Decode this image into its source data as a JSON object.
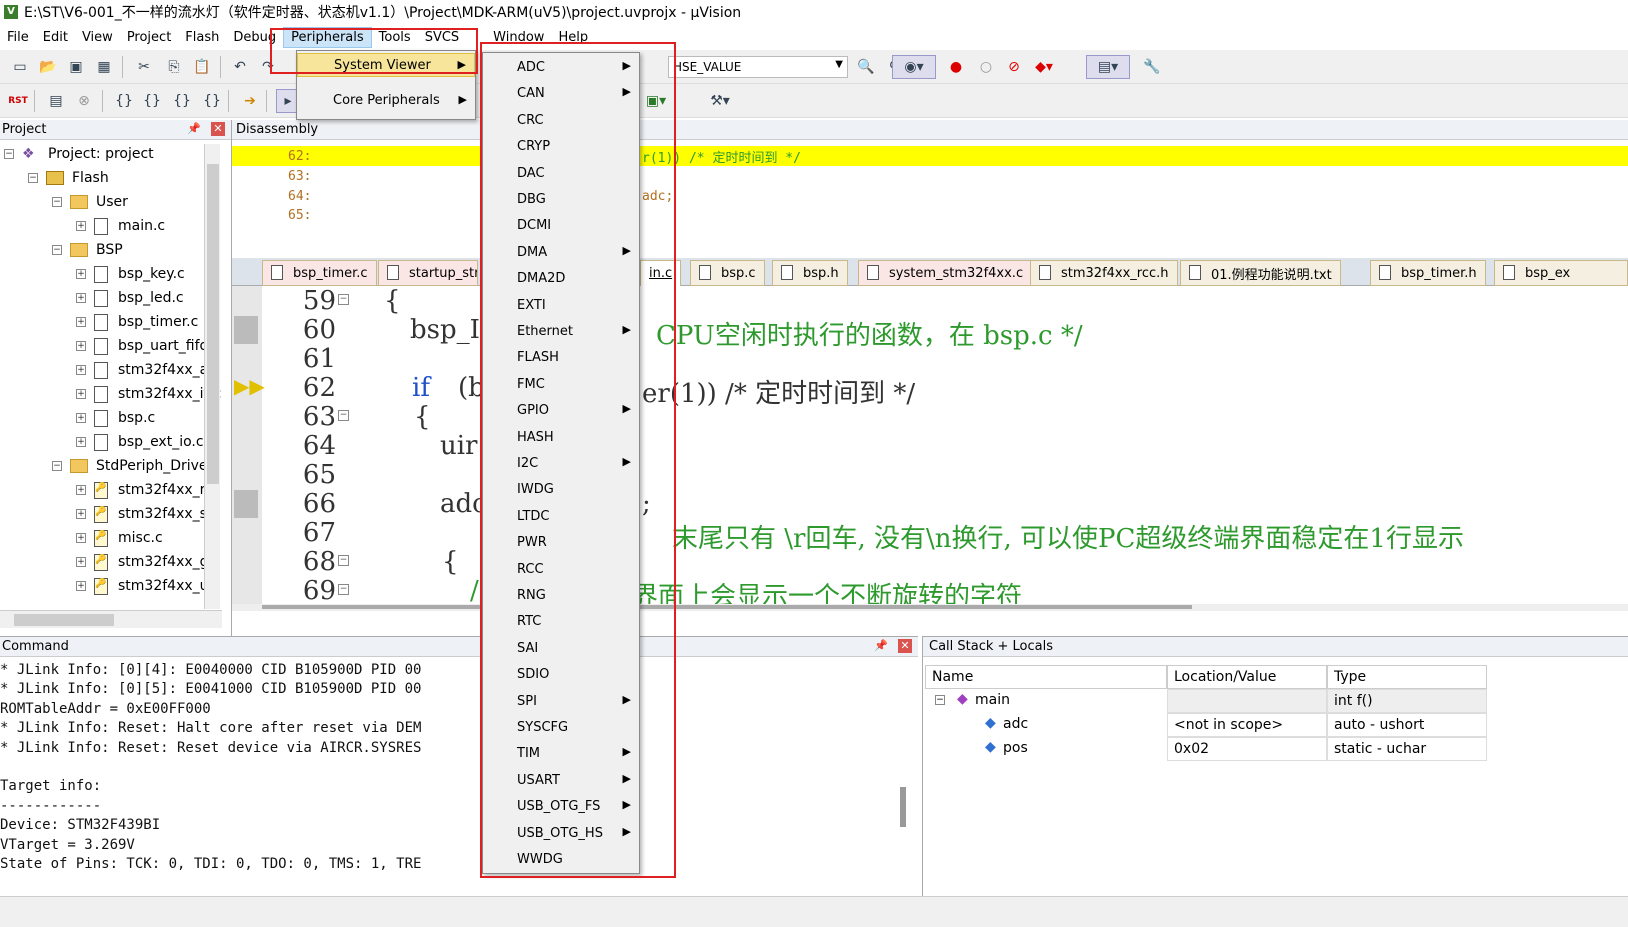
{
  "title": "E:\\ST\\V6-001_不一样的流水灯（软件定时器、状态机v1.1）\\Project\\MDK-ARM(uV5)\\project.uvprojx - µVision",
  "menubar": [
    "File",
    "Edit",
    "View",
    "Project",
    "Flash",
    "Debug",
    "Peripherals",
    "Tools",
    "SVCS",
    "Window",
    "Help"
  ],
  "toolbar": {
    "hse_value": "HSE_VALUE",
    "rst_label": "RST"
  },
  "project_panel": {
    "title": "Project",
    "items": [
      {
        "label": "Project: project",
        "level": 0,
        "kind": "project"
      },
      {
        "label": "Flash",
        "level": 1,
        "kind": "flash"
      },
      {
        "label": "User",
        "level": 2,
        "kind": "folder"
      },
      {
        "label": "main.c",
        "level": 3,
        "kind": "file"
      },
      {
        "label": "BSP",
        "level": 2,
        "kind": "folder"
      },
      {
        "label": "bsp_key.c",
        "level": 3,
        "kind": "file"
      },
      {
        "label": "bsp_led.c",
        "level": 3,
        "kind": "file"
      },
      {
        "label": "bsp_timer.c",
        "level": 3,
        "kind": "file"
      },
      {
        "label": "bsp_uart_fifo.",
        "level": 3,
        "kind": "file"
      },
      {
        "label": "stm32f4xx_as:",
        "level": 3,
        "kind": "file"
      },
      {
        "label": "stm32f4xx_it.c",
        "level": 3,
        "kind": "file"
      },
      {
        "label": "bsp.c",
        "level": 3,
        "kind": "file"
      },
      {
        "label": "bsp_ext_io.c",
        "level": 3,
        "kind": "file"
      },
      {
        "label": "StdPeriph_Driver",
        "level": 2,
        "kind": "folder"
      },
      {
        "label": "stm32f4xx_rcc",
        "level": 3,
        "kind": "hdr"
      },
      {
        "label": "stm32f4xx_sy:",
        "level": 3,
        "kind": "hdr"
      },
      {
        "label": "misc.c",
        "level": 3,
        "kind": "hdr"
      },
      {
        "label": "stm32f4xx_gp",
        "level": 3,
        "kind": "hdr"
      },
      {
        "label": "stm32f4xx_us",
        "level": 3,
        "kind": "hdr"
      }
    ]
  },
  "disassembly": {
    "title": "Disassembly",
    "lines": [
      "62:",
      "63:",
      "64:",
      "65:"
    ],
    "right_line1": "r(1)) /* 定时时间到 */",
    "right_line2": "adc;"
  },
  "tabs": [
    "bsp_timer.c",
    "startup_str",
    "in.c",
    "bsp.c",
    "bsp.h",
    "system_stm32f4xx.c",
    "stm32f4xx_rcc.h",
    "01.例程功能说明.txt",
    "bsp_timer.h",
    "bsp_ex"
  ],
  "editor": {
    "line_numbers": [
      "59",
      "60",
      "61",
      "62",
      "63",
      "64",
      "65",
      "66",
      "67",
      "68",
      "69"
    ],
    "code": {
      "l59": "{",
      "l60a": "bsp_I",
      "l60b": "CPU空闲时执行的函数，在 bsp.c */",
      "l62a": "if",
      "l62b": "(b",
      "l62c": "er(1)) /* 定时时间到 */",
      "l63": "{",
      "l64": "uir",
      "l66a": "adc",
      "l66b": ";",
      "l67a": "{",
      "l67b": "末尾只有 \\r回车, 没有\\n换行, 可以使PC超级终端界面稳定在1行显示",
      "l69a": "/",
      "l69b": "界面上会显示一个不断旋转的字符"
    }
  },
  "command": {
    "title": "Command",
    "lines": [
      "* JLink Info: [0][4]: E0040000 CID B105900D PID 00",
      "* JLink Info: [0][5]: E0041000 CID B105900D PID 00",
      "ROMTableAddr = 0xE00FF000",
      "* JLink Info: Reset: Halt core after reset via DEM",
      "* JLink Info: Reset: Reset device via AIRCR.SYSRES",
      "",
      "Target info:",
      "------------",
      "Device: STM32F439BI",
      "VTarget = 3.269V",
      "State of Pins: TCK: 0, TDI: 0, TDO: 0, TMS: 1, TRE"
    ]
  },
  "callstack": {
    "title": "Call Stack + Locals",
    "columns": [
      "Name",
      "Location/Value",
      "Type"
    ],
    "rows": [
      {
        "name": "main",
        "value": "",
        "type": "int f()"
      },
      {
        "name": "adc",
        "value": "<not in scope>",
        "type": "auto - ushort"
      },
      {
        "name": "pos",
        "value": "0x02",
        "type": "static - uchar"
      }
    ]
  },
  "peripherals_menu": {
    "items": [
      {
        "label": "System Viewer",
        "submenu": true
      },
      {
        "label": "Core Peripherals",
        "submenu": true
      }
    ]
  },
  "system_viewer_menu": {
    "items": [
      {
        "label": "ADC",
        "submenu": true
      },
      {
        "label": "CAN",
        "submenu": true
      },
      {
        "label": "CRC",
        "submenu": false
      },
      {
        "label": "CRYP",
        "submenu": false
      },
      {
        "label": "DAC",
        "submenu": false
      },
      {
        "label": "DBG",
        "submenu": false
      },
      {
        "label": "DCMI",
        "submenu": false
      },
      {
        "label": "DMA",
        "submenu": true
      },
      {
        "label": "DMA2D",
        "submenu": false
      },
      {
        "label": "EXTI",
        "submenu": false
      },
      {
        "label": "Ethernet",
        "submenu": true
      },
      {
        "label": "FLASH",
        "submenu": false
      },
      {
        "label": "FMC",
        "submenu": false
      },
      {
        "label": "GPIO",
        "submenu": true
      },
      {
        "label": "HASH",
        "submenu": false
      },
      {
        "label": "I2C",
        "submenu": true
      },
      {
        "label": "IWDG",
        "submenu": false
      },
      {
        "label": "LTDC",
        "submenu": false
      },
      {
        "label": "PWR",
        "submenu": false
      },
      {
        "label": "RCC",
        "submenu": false
      },
      {
        "label": "RNG",
        "submenu": false
      },
      {
        "label": "RTC",
        "submenu": false
      },
      {
        "label": "SAI",
        "submenu": false
      },
      {
        "label": "SDIO",
        "submenu": false
      },
      {
        "label": "SPI",
        "submenu": true
      },
      {
        "label": "SYSCFG",
        "submenu": false
      },
      {
        "label": "TIM",
        "submenu": true
      },
      {
        "label": "USART",
        "submenu": true
      },
      {
        "label": "USB_OTG_FS",
        "submenu": true
      },
      {
        "label": "USB_OTG_HS",
        "submenu": true
      },
      {
        "label": "WWDG",
        "submenu": false
      }
    ]
  },
  "colors": {
    "highlight_yellow": "#ffff00",
    "annotation_red": "#e02020",
    "menu_selected": "#f6e59a",
    "comment_green": "#2e9a2e",
    "keyword_blue": "#1e50c8"
  }
}
